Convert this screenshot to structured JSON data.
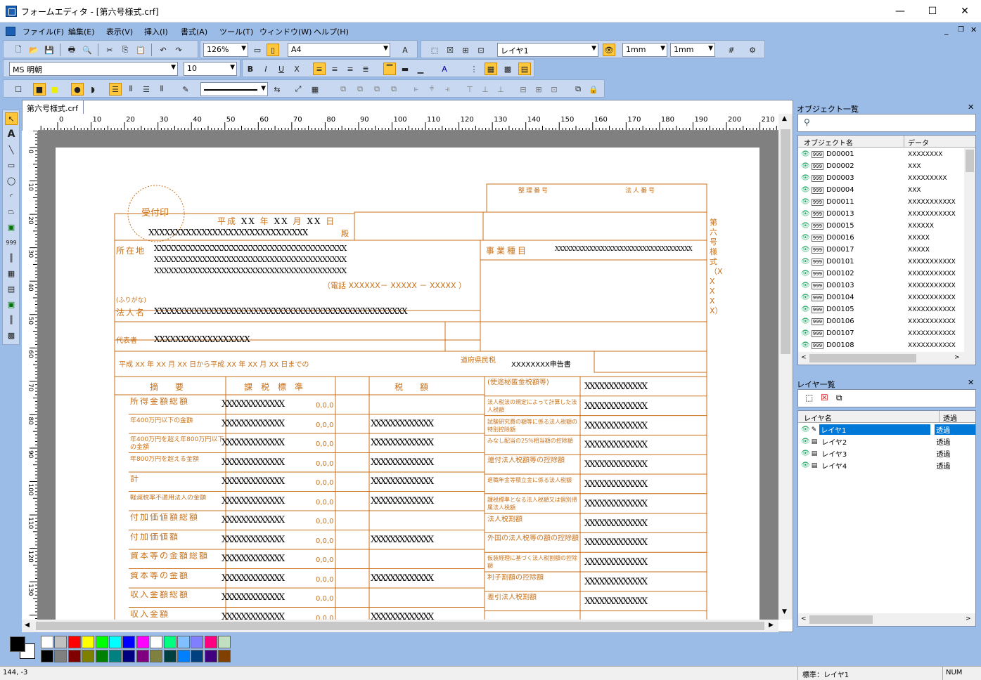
{
  "window": {
    "title": "フォームエディタ - [第六号様式.crf]",
    "minimize": "—",
    "maximize": "☐",
    "close": "✕"
  },
  "menu": [
    "ファイル(F)",
    "編集(E)",
    "表示(V)",
    "挿入(I)",
    "書式(A)",
    "ツール(T)",
    "ウィンドウ(W)",
    "ヘルプ(H)"
  ],
  "toolbar1": {
    "zoom": "126%",
    "paper": "A4",
    "layer": "レイヤ1",
    "grid_x": "1mm",
    "grid_y": "1mm"
  },
  "toolbar2": {
    "font": "MS 明朝",
    "size": "10",
    "bold": "B",
    "italic": "I",
    "underline": "U",
    "strike": "X"
  },
  "document": {
    "tab": "第六号様式.crf"
  },
  "ruler": {
    "h_ticks": [
      "0",
      "10",
      "20",
      "30",
      "40",
      "50",
      "60",
      "70",
      "80",
      "90",
      "100",
      "110",
      "120",
      "130",
      "140",
      "150",
      "160",
      "170",
      "180",
      "190",
      "200",
      "210"
    ],
    "v_ticks": [
      "0",
      "10",
      "20",
      "30",
      "40",
      "50",
      "60",
      "70",
      "80",
      "90",
      "100",
      "110",
      "120",
      "130"
    ]
  },
  "form": {
    "uketsuke": "受付印",
    "heisei": "平成",
    "date_year": "XX",
    "date_mark_year": "年",
    "date_month": "XX",
    "date_mark_month": "月",
    "date_day": "XX",
    "date_mark_day": "日",
    "addressee": "XXXXXXXXXXXXXXXXXXXXXXXXXXXXXX",
    "addressee_suffix": "殿",
    "shozaichi": "所在地",
    "address_lines": [
      "XXXXXXXXXXXXXXXXXXXXXXXXXXXXXXXXXXXXXXXX",
      "XXXXXXXXXXXXXXXXXXXXXXXXXXXXXXXXXXXXXXXX",
      "XXXXXXXXXXXXXXXXXXXXXXXXXXXXXXXXXXXXXXXX"
    ],
    "phone": "（電話 XXXXXX－ XXXXX － XXXXX ）",
    "furigana": "(ふりがな)",
    "houjinmei": "法人名",
    "corp_name": "XXXXXXXXXXXXXXXXXXXXXXXXXXXXXXXXXXXXXXXXXXXXXXXXXXX",
    "daihyousha": "代表者",
    "rep_name": "XXXXXXXXXXXXXXXXXX",
    "jigyou_shumoku": "事業種目",
    "jigyou_value": "XXXXXXXXXXXXXXXXXXXXXXXXXXXXXXXXXXXX",
    "seiri_bango": "整理番号",
    "houjin_bango": "法人番号",
    "period_text": "平成 XX 年 XX 月 XX 日から平成 XX 年 XX 月 XX 日までの",
    "tax_title": "道府県民税",
    "report_suffix": "XXXXXXXX申告書",
    "vertical_title": "第六号様式（XXXXX）",
    "headers": [
      "摘　　要",
      "課　税　標　準",
      "税　　額"
    ],
    "rows": [
      "所得金額総額",
      "年400万円以下の金額",
      "年400万円を超え年800万円以下の金額",
      "年800万円を超える金額",
      "計",
      "軽減税率不適用法人の金額",
      "付加価値額総額",
      "付加価値額",
      "資本等の金額総額",
      "資本等の金額",
      "収入金額総額",
      "収入金額"
    ],
    "right_rows": [
      "(使途秘匿金税額等)",
      "法人税法の規定によって計算した法人税額",
      "試験研究費の額等に係る法人税額の特別控除額",
      "みなし配当の25%相当額の控除額",
      "還付法人税額等の控除額",
      "退職年金等積立金に係る法人税額",
      "課税標準となる法人税額又は個別帰属法人税額",
      "法人税割額",
      "外国の法人税等の額の控除額",
      "仮装経理に基づく法人税割額の控除額",
      "利子割額の控除額",
      "差引法人税割額"
    ],
    "xs": "XXXXXXXXXXXXX",
    "zeros": "0,0,0"
  },
  "objects_panel": {
    "title": "オブジェクト一覧",
    "col_name": "オブジェクト名",
    "col_data": "データ",
    "rows": [
      {
        "name": "D00001",
        "data": "XXXXXXXX"
      },
      {
        "name": "D00002",
        "data": "XXX"
      },
      {
        "name": "D00003",
        "data": "XXXXXXXXX"
      },
      {
        "name": "D00004",
        "data": "XXX"
      },
      {
        "name": "D00011",
        "data": "XXXXXXXXXXX"
      },
      {
        "name": "D00013",
        "data": "XXXXXXXXXXX"
      },
      {
        "name": "D00015",
        "data": "XXXXXX"
      },
      {
        "name": "D00016",
        "data": "XXXXX"
      },
      {
        "name": "D00017",
        "data": "XXXXX"
      },
      {
        "name": "D00101",
        "data": "XXXXXXXXXXX"
      },
      {
        "name": "D00102",
        "data": "XXXXXXXXXXX"
      },
      {
        "name": "D00103",
        "data": "XXXXXXXXXXX"
      },
      {
        "name": "D00104",
        "data": "XXXXXXXXXXX"
      },
      {
        "name": "D00105",
        "data": "XXXXXXXXXXX"
      },
      {
        "name": "D00106",
        "data": "XXXXXXXXXXX"
      },
      {
        "name": "D00107",
        "data": "XXXXXXXXXXX"
      },
      {
        "name": "D00108",
        "data": "XXXXXXXXXXX"
      }
    ]
  },
  "layers_panel": {
    "title": "レイヤ一覧",
    "col_name": "レイヤ名",
    "col_trans": "透過",
    "rows": [
      {
        "name": "レイヤ1",
        "trans": "透過",
        "selected": true
      },
      {
        "name": "レイヤ2",
        "trans": "透過"
      },
      {
        "name": "レイヤ3",
        "trans": "透過"
      },
      {
        "name": "レイヤ4",
        "trans": "透過"
      }
    ]
  },
  "palette": [
    "#ffffff",
    "#c0c0c0",
    "#ff0000",
    "#ffff00",
    "#00ff00",
    "#00ffff",
    "#0000ff",
    "#ff00ff",
    "#ffffff",
    "#00ff80",
    "#80c0ff",
    "#8080ff",
    "#ff0080",
    "#c0e0c0",
    "#000000",
    "#808080",
    "#800000",
    "#808000",
    "#008000",
    "#008080",
    "#000080",
    "#800080",
    "#808040",
    "#004040",
    "#0080ff",
    "#004080",
    "#400080",
    "#804000"
  ],
  "status": {
    "coords": "144, -3",
    "layer": "標準：レイヤ1",
    "num": "NUM"
  },
  "colors": {
    "form": "#c9721a",
    "accent": "#0078d7"
  }
}
